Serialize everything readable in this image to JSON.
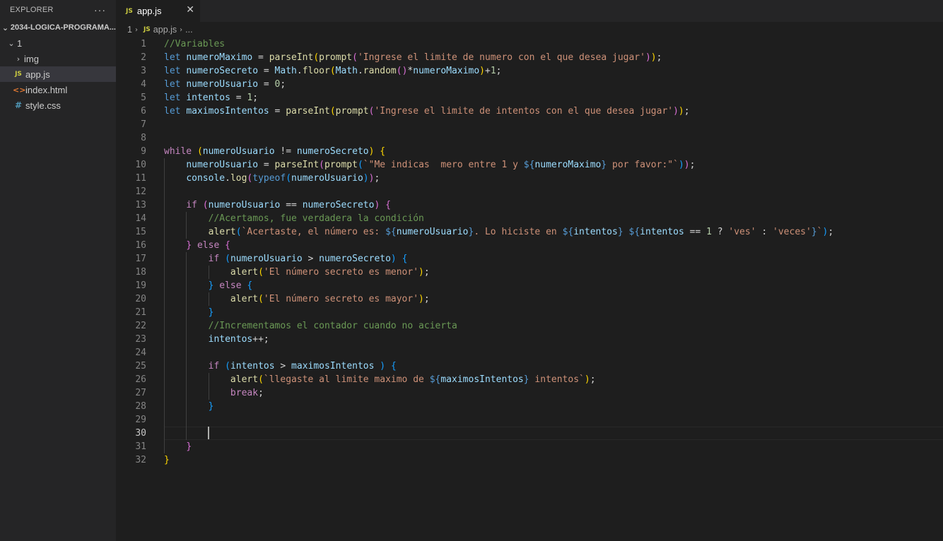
{
  "explorer": {
    "title": "EXPLORER",
    "more": "···",
    "root": "2034-LOGICA-PROGRAMA...",
    "folder": "1",
    "items": [
      {
        "label": "img",
        "type": "folder"
      },
      {
        "label": "app.js",
        "type": "js",
        "selected": true
      },
      {
        "label": "index.html",
        "type": "html"
      },
      {
        "label": "style.css",
        "type": "css"
      }
    ]
  },
  "tab": {
    "icon": "JS",
    "label": "app.js",
    "close": "✕"
  },
  "breadcrumb": [
    "1",
    "app.js",
    "..."
  ],
  "editor": {
    "current_line": 30,
    "lines": [
      [
        [
          "//Variables",
          "t-com"
        ]
      ],
      [
        [
          "let",
          "t-kw"
        ],
        [
          " ",
          ""
        ],
        [
          "numeroMaximo",
          "t-var"
        ],
        [
          " = ",
          ""
        ],
        [
          "parseInt",
          "t-fn"
        ],
        [
          "(",
          "t-b1"
        ],
        [
          "prompt",
          "t-fn"
        ],
        [
          "(",
          "t-b2"
        ],
        [
          "'Ingrese el limite de numero con el que desea jugar'",
          "t-str"
        ],
        [
          ")",
          "t-b2"
        ],
        [
          ")",
          "t-b1"
        ],
        [
          ";",
          ""
        ]
      ],
      [
        [
          "let",
          "t-kw"
        ],
        [
          " ",
          ""
        ],
        [
          "numeroSecreto",
          "t-var"
        ],
        [
          " = ",
          ""
        ],
        [
          "Math",
          "t-var"
        ],
        [
          ".",
          ""
        ],
        [
          "floor",
          "t-fn"
        ],
        [
          "(",
          "t-b1"
        ],
        [
          "Math",
          "t-var"
        ],
        [
          ".",
          ""
        ],
        [
          "random",
          "t-fn"
        ],
        [
          "()",
          "t-b2"
        ],
        [
          "*",
          ""
        ],
        [
          "numeroMaximo",
          "t-var"
        ],
        [
          ")",
          "t-b1"
        ],
        [
          "+",
          ""
        ],
        [
          "1",
          "t-num"
        ],
        [
          ";",
          ""
        ]
      ],
      [
        [
          "let",
          "t-kw"
        ],
        [
          " ",
          ""
        ],
        [
          "numeroUsuario",
          "t-var"
        ],
        [
          " = ",
          ""
        ],
        [
          "0",
          "t-num"
        ],
        [
          ";",
          ""
        ]
      ],
      [
        [
          "let",
          "t-kw"
        ],
        [
          " ",
          ""
        ],
        [
          "intentos",
          "t-var"
        ],
        [
          " = ",
          ""
        ],
        [
          "1",
          "t-num"
        ],
        [
          ";",
          ""
        ]
      ],
      [
        [
          "let",
          "t-kw"
        ],
        [
          " ",
          ""
        ],
        [
          "maximosIntentos",
          "t-var"
        ],
        [
          " = ",
          ""
        ],
        [
          "parseInt",
          "t-fn"
        ],
        [
          "(",
          "t-b1"
        ],
        [
          "prompt",
          "t-fn"
        ],
        [
          "(",
          "t-b2"
        ],
        [
          "'Ingrese el limite de intentos con el que desea jugar'",
          "t-str"
        ],
        [
          ")",
          "t-b2"
        ],
        [
          ")",
          "t-b1"
        ],
        [
          ";",
          ""
        ]
      ],
      [],
      [],
      [
        [
          "while",
          "t-ctl"
        ],
        [
          " ",
          ""
        ],
        [
          "(",
          "t-b1"
        ],
        [
          "numeroUsuario",
          "t-var"
        ],
        [
          " != ",
          ""
        ],
        [
          "numeroSecreto",
          "t-var"
        ],
        [
          ")",
          "t-b1"
        ],
        [
          " ",
          ""
        ],
        [
          "{",
          "t-b1"
        ]
      ],
      [
        [
          "    ",
          ""
        ],
        [
          "numeroUsuario",
          "t-var"
        ],
        [
          " = ",
          ""
        ],
        [
          "parseInt",
          "t-fn"
        ],
        [
          "(",
          "t-b2"
        ],
        [
          "prompt",
          "t-fn"
        ],
        [
          "(",
          "t-b3"
        ],
        [
          "`\"Me indicas  mero entre 1 y ",
          "t-str"
        ],
        [
          "${",
          "t-tpl"
        ],
        [
          "numeroMaximo",
          "t-var"
        ],
        [
          "}",
          "t-tpl"
        ],
        [
          " por favor:\"`",
          "t-str"
        ],
        [
          ")",
          "t-b3"
        ],
        [
          ")",
          "t-b2"
        ],
        [
          ";",
          ""
        ]
      ],
      [
        [
          "    ",
          ""
        ],
        [
          "console",
          "t-var"
        ],
        [
          ".",
          ""
        ],
        [
          "log",
          "t-fn"
        ],
        [
          "(",
          "t-b2"
        ],
        [
          "typeof",
          "t-kw"
        ],
        [
          "(",
          "t-b3"
        ],
        [
          "numeroUsuario",
          "t-var"
        ],
        [
          ")",
          "t-b3"
        ],
        [
          ")",
          "t-b2"
        ],
        [
          ";",
          ""
        ]
      ],
      [],
      [
        [
          "    ",
          ""
        ],
        [
          "if",
          "t-ctl"
        ],
        [
          " ",
          ""
        ],
        [
          "(",
          "t-b2"
        ],
        [
          "numeroUsuario",
          "t-var"
        ],
        [
          " == ",
          ""
        ],
        [
          "numeroSecreto",
          "t-var"
        ],
        [
          ")",
          "t-b2"
        ],
        [
          " ",
          ""
        ],
        [
          "{",
          "t-b2"
        ]
      ],
      [
        [
          "        ",
          ""
        ],
        [
          "//Acertamos, fue verdadera la condición",
          "t-com"
        ]
      ],
      [
        [
          "        ",
          ""
        ],
        [
          "alert",
          "t-fn"
        ],
        [
          "(",
          "t-b3"
        ],
        [
          "`Acertaste, el número es: ",
          "t-str"
        ],
        [
          "${",
          "t-tpl"
        ],
        [
          "numeroUsuario",
          "t-var"
        ],
        [
          "}",
          "t-tpl"
        ],
        [
          ". Lo hiciste en ",
          "t-str"
        ],
        [
          "${",
          "t-tpl"
        ],
        [
          "intentos",
          "t-var"
        ],
        [
          "}",
          "t-tpl"
        ],
        [
          " ",
          "t-str"
        ],
        [
          "${",
          "t-tpl"
        ],
        [
          "intentos",
          "t-var"
        ],
        [
          " == ",
          ""
        ],
        [
          "1",
          "t-num"
        ],
        [
          " ? ",
          ""
        ],
        [
          "'ves'",
          "t-str"
        ],
        [
          " : ",
          ""
        ],
        [
          "'veces'",
          "t-str"
        ],
        [
          "}",
          "t-tpl"
        ],
        [
          "`",
          "t-str"
        ],
        [
          ")",
          "t-b3"
        ],
        [
          ";",
          ""
        ]
      ],
      [
        [
          "    ",
          ""
        ],
        [
          "}",
          "t-b2"
        ],
        [
          " ",
          ""
        ],
        [
          "else",
          "t-ctl"
        ],
        [
          " ",
          ""
        ],
        [
          "{",
          "t-b2"
        ]
      ],
      [
        [
          "        ",
          ""
        ],
        [
          "if",
          "t-ctl"
        ],
        [
          " ",
          ""
        ],
        [
          "(",
          "t-b3"
        ],
        [
          "numeroUsuario",
          "t-var"
        ],
        [
          " > ",
          ""
        ],
        [
          "numeroSecreto",
          "t-var"
        ],
        [
          ")",
          "t-b3"
        ],
        [
          " ",
          ""
        ],
        [
          "{",
          "t-b3"
        ]
      ],
      [
        [
          "            ",
          ""
        ],
        [
          "alert",
          "t-fn"
        ],
        [
          "(",
          "t-b1"
        ],
        [
          "'El número secreto es menor'",
          "t-str"
        ],
        [
          ")",
          "t-b1"
        ],
        [
          ";",
          ""
        ]
      ],
      [
        [
          "        ",
          ""
        ],
        [
          "}",
          "t-b3"
        ],
        [
          " ",
          ""
        ],
        [
          "else",
          "t-ctl"
        ],
        [
          " ",
          ""
        ],
        [
          "{",
          "t-b3"
        ]
      ],
      [
        [
          "            ",
          ""
        ],
        [
          "alert",
          "t-fn"
        ],
        [
          "(",
          "t-b1"
        ],
        [
          "'El número secreto es mayor'",
          "t-str"
        ],
        [
          ")",
          "t-b1"
        ],
        [
          ";",
          ""
        ]
      ],
      [
        [
          "        ",
          ""
        ],
        [
          "}",
          "t-b3"
        ]
      ],
      [
        [
          "        ",
          ""
        ],
        [
          "//Incrementamos el contador cuando no acierta",
          "t-com"
        ]
      ],
      [
        [
          "        ",
          ""
        ],
        [
          "intentos",
          "t-var"
        ],
        [
          "++;",
          ""
        ]
      ],
      [],
      [
        [
          "        ",
          ""
        ],
        [
          "if",
          "t-ctl"
        ],
        [
          " ",
          ""
        ],
        [
          "(",
          "t-b3"
        ],
        [
          "intentos",
          "t-var"
        ],
        [
          " > ",
          ""
        ],
        [
          "maximosIntentos",
          "t-var"
        ],
        [
          " ",
          ""
        ],
        [
          ")",
          "t-b3"
        ],
        [
          " ",
          ""
        ],
        [
          "{",
          "t-b3"
        ]
      ],
      [
        [
          "            ",
          ""
        ],
        [
          "alert",
          "t-fn"
        ],
        [
          "(",
          "t-b1"
        ],
        [
          "`llegaste al limite maximo de ",
          "t-str"
        ],
        [
          "${",
          "t-tpl"
        ],
        [
          "maximosIntentos",
          "t-var"
        ],
        [
          "}",
          "t-tpl"
        ],
        [
          " intentos`",
          "t-str"
        ],
        [
          ")",
          "t-b1"
        ],
        [
          ";",
          ""
        ]
      ],
      [
        [
          "            ",
          ""
        ],
        [
          "break",
          "t-ctl"
        ],
        [
          ";",
          ""
        ]
      ],
      [
        [
          "        ",
          ""
        ],
        [
          "}",
          "t-b3"
        ]
      ],
      [],
      [],
      [
        [
          "    ",
          ""
        ],
        [
          "}",
          "t-b2"
        ]
      ],
      [
        [
          "}",
          "t-b1"
        ]
      ]
    ]
  }
}
